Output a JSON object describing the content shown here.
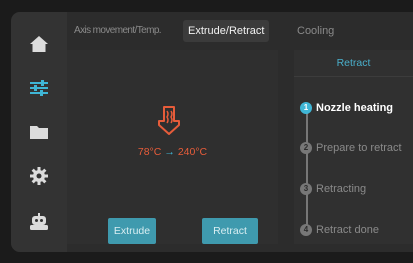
{
  "sidebar": {
    "items": [
      {
        "icon": "home-icon"
      },
      {
        "icon": "sliders-icon",
        "active": true
      },
      {
        "icon": "folder-icon"
      },
      {
        "icon": "gear-icon"
      },
      {
        "icon": "robot-icon"
      }
    ]
  },
  "tabs": [
    {
      "label": "Axis movement/Temp."
    },
    {
      "label": "Extrude/Retract",
      "active": true
    },
    {
      "label": "Cooling"
    }
  ],
  "extrude": {
    "heater_icon": "nozzle-heater-icon",
    "temp_current": "78°C",
    "temp_target": "240°C",
    "extrude_label": "Extrude",
    "retract_label": "Retract"
  },
  "retract_panel": {
    "title": "Retract",
    "steps": [
      {
        "num": "1",
        "label": "Nozzle heating",
        "active": true
      },
      {
        "num": "2",
        "label": "Prepare to retract"
      },
      {
        "num": "3",
        "label": "Retracting"
      },
      {
        "num": "4",
        "label": "Retract done"
      }
    ]
  },
  "colors": {
    "accent": "#3fb6d6",
    "heat": "#e65c3a",
    "button": "#3f9aae"
  }
}
